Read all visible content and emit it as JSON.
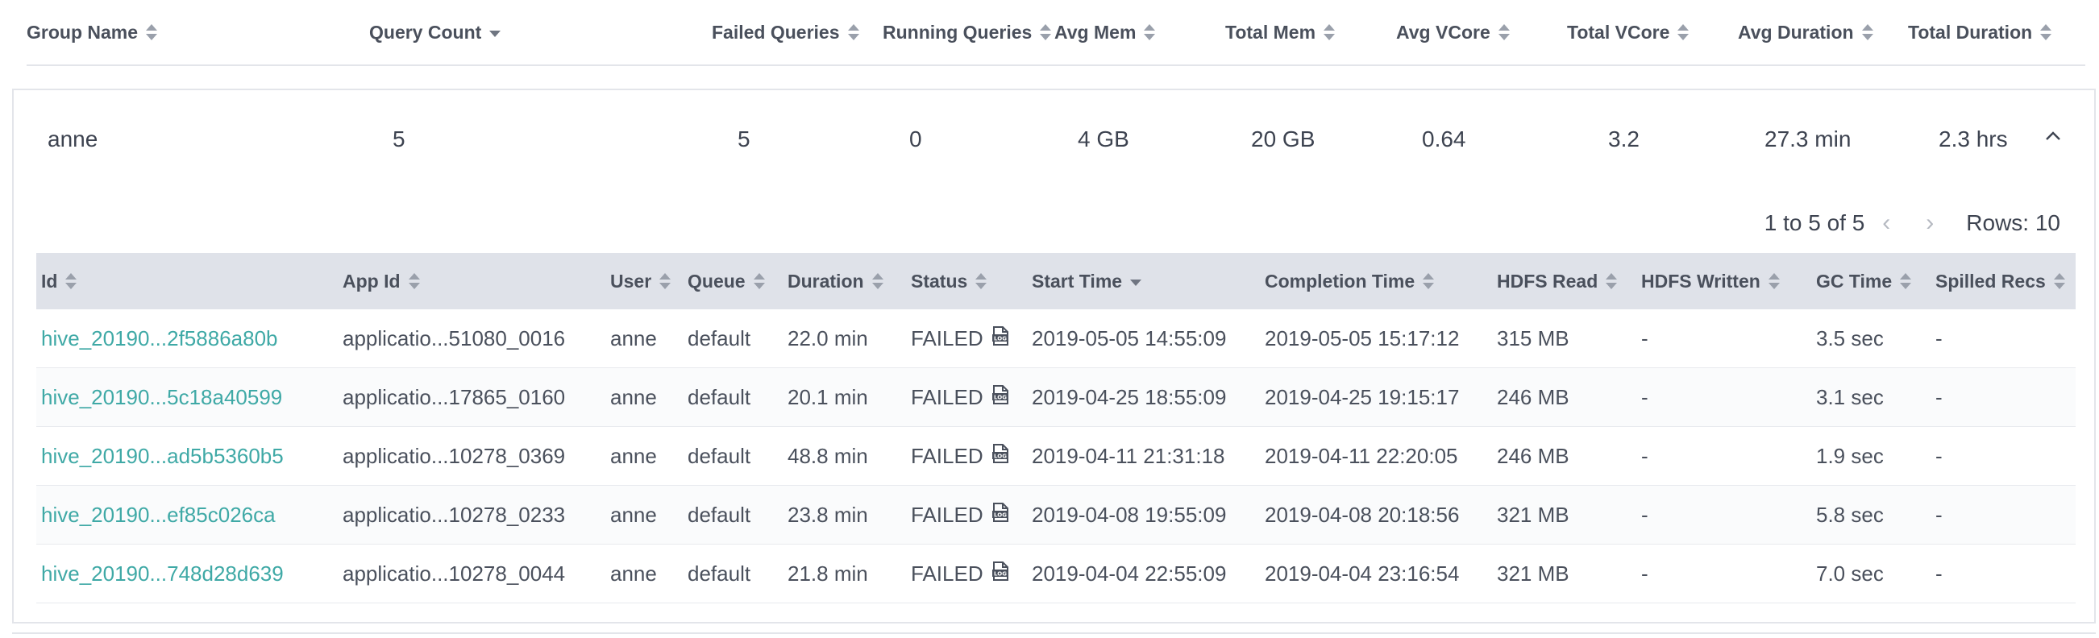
{
  "header": {
    "columns": [
      {
        "label": "Group Name",
        "sort": "both"
      },
      {
        "label": "Query Count",
        "sort": "desc"
      },
      {
        "label": "Failed Queries",
        "sort": "both"
      },
      {
        "label": "Running Queries",
        "sort": "both"
      },
      {
        "label": "Avg Mem",
        "sort": "both"
      },
      {
        "label": "Total Mem",
        "sort": "both"
      },
      {
        "label": "Avg VCore",
        "sort": "both"
      },
      {
        "label": "Total VCore",
        "sort": "both"
      },
      {
        "label": "Avg Duration",
        "sort": "both"
      },
      {
        "label": "Total Duration",
        "sort": "both"
      }
    ]
  },
  "group": {
    "name": "anne",
    "query_count": "5",
    "failed_queries": "5",
    "running_queries": "0",
    "avg_mem": "4 GB",
    "total_mem": "20 GB",
    "avg_vcore": "0.64",
    "total_vcore": "3.2",
    "avg_duration": "27.3 min",
    "total_duration": "2.3 hrs"
  },
  "pager": {
    "range": "1 to 5 of 5",
    "prev": "‹",
    "next": "›",
    "rows": "Rows: 10"
  },
  "detail": {
    "columns": [
      {
        "label": "Id",
        "sort": "both"
      },
      {
        "label": "App Id",
        "sort": "both"
      },
      {
        "label": "User",
        "sort": "both"
      },
      {
        "label": "Queue",
        "sort": "both"
      },
      {
        "label": "Duration",
        "sort": "both"
      },
      {
        "label": "Status",
        "sort": "both"
      },
      {
        "label": "Start Time",
        "sort": "desc"
      },
      {
        "label": "Completion Time",
        "sort": "both"
      },
      {
        "label": "HDFS Read",
        "sort": "both"
      },
      {
        "label": "HDFS Written",
        "sort": "both"
      },
      {
        "label": "GC Time",
        "sort": "both"
      },
      {
        "label": "Spilled Recs",
        "sort": "both"
      }
    ],
    "rows": [
      [
        "hive_20190...2f5886a80b",
        "applicatio...51080_0016",
        "anne",
        "default",
        "22.0 min",
        "FAILED",
        "2019-05-05 14:55:09",
        "2019-05-05 15:17:12",
        "315 MB",
        "-",
        "3.5 sec",
        "-"
      ],
      [
        "hive_20190...5c18a40599",
        "applicatio...17865_0160",
        "anne",
        "default",
        "20.1 min",
        "FAILED",
        "2019-04-25 18:55:09",
        "2019-04-25 19:15:17",
        "246 MB",
        "-",
        "3.1 sec",
        "-"
      ],
      [
        "hive_20190...ad5b5360b5",
        "applicatio...10278_0369",
        "anne",
        "default",
        "48.8 min",
        "FAILED",
        "2019-04-11 21:31:18",
        "2019-04-11 22:20:05",
        "246 MB",
        "-",
        "1.9 sec",
        "-"
      ],
      [
        "hive_20190...ef85c026ca",
        "applicatio...10278_0233",
        "anne",
        "default",
        "23.8 min",
        "FAILED",
        "2019-04-08 19:55:09",
        "2019-04-08 20:18:56",
        "321 MB",
        "-",
        "5.8 sec",
        "-"
      ],
      [
        "hive_20190...748d28d639",
        "applicatio...10278_0044",
        "anne",
        "default",
        "21.8 min",
        "FAILED",
        "2019-04-04 22:55:09",
        "2019-04-04 23:16:54",
        "321 MB",
        "-",
        "7.0 sec",
        "-"
      ]
    ]
  },
  "colors": {
    "link": "#3fa9a6",
    "header_bg": "#dfe2e9",
    "text": "#3d4350"
  }
}
